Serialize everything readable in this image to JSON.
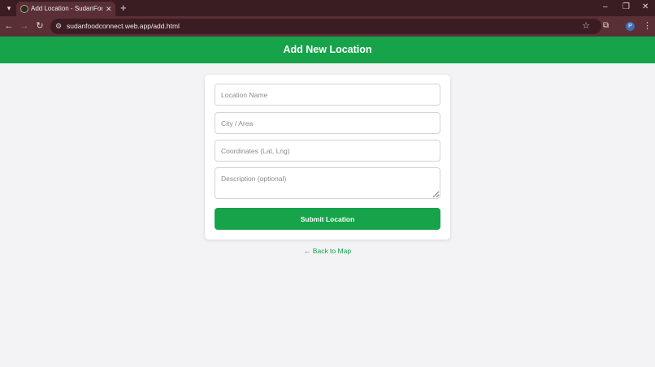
{
  "browser": {
    "tab_title": "Add Location - SudanFoodConn",
    "url": "sudanfoodconnect.web.app/add.html",
    "profile_initial": "P",
    "icons": {
      "tab_search": "chevron-down-icon",
      "tab_close": "close-icon",
      "new_tab": "plus-icon",
      "back": "arrow-left-icon",
      "forward": "arrow-right-icon",
      "reload": "reload-icon",
      "site_info": "tune-icon",
      "bookmark": "star-icon",
      "extensions": "puzzle-icon",
      "menu": "kebab-menu-icon",
      "minimize": "minimize-icon",
      "restore": "restore-icon",
      "close_window": "close-icon"
    }
  },
  "header": {
    "title": "Add New Location"
  },
  "form": {
    "location_name": {
      "placeholder": "Location Name",
      "value": ""
    },
    "city": {
      "placeholder": "City / Area",
      "value": ""
    },
    "coordinates": {
      "placeholder": "Coordinates (Lat, Lng)",
      "value": ""
    },
    "description": {
      "placeholder": "Description (optional)",
      "value": ""
    },
    "submit_label": "Submit Location"
  },
  "back_link": "← Back to Map",
  "colors": {
    "accent": "#16a34a",
    "page_bg": "#f3f3f5",
    "browser_frame": "#3a1d22",
    "browser_toolbar": "#5a2f36"
  }
}
